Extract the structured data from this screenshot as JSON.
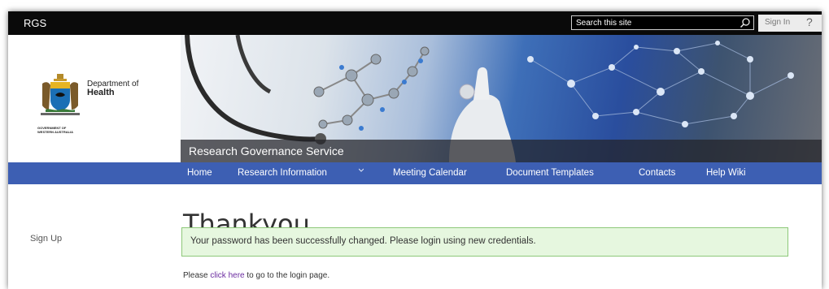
{
  "suitebar": {
    "brand": "RGS",
    "search_placeholder": "Search this site",
    "signin": "Sign In",
    "help": "?"
  },
  "header": {
    "dept_line1": "Department of",
    "dept_line2": "Health",
    "gov_line1": "GOVERNMENT OF",
    "gov_line2": "WESTERN AUSTRALIA",
    "banner_title": "Research Governance Service"
  },
  "nav": {
    "items": [
      "Home",
      "Research Information",
      "Meeting Calendar",
      "Document Templates",
      "Contacts",
      "Help Wiki"
    ]
  },
  "sidebar": {
    "signup": "Sign Up"
  },
  "main": {
    "title": "Thankyou",
    "success_message": "Your password has been successfully changed. Please login using new credentials.",
    "login_prefix": "Please ",
    "login_link": "click here",
    "login_suffix": " to go to the login page."
  },
  "colors": {
    "suitebar": "#0a0a0a",
    "nav": "#3d5fb3",
    "success_bg": "#e6f7df",
    "success_border": "#8dc879",
    "link": "#6b2ca0"
  }
}
